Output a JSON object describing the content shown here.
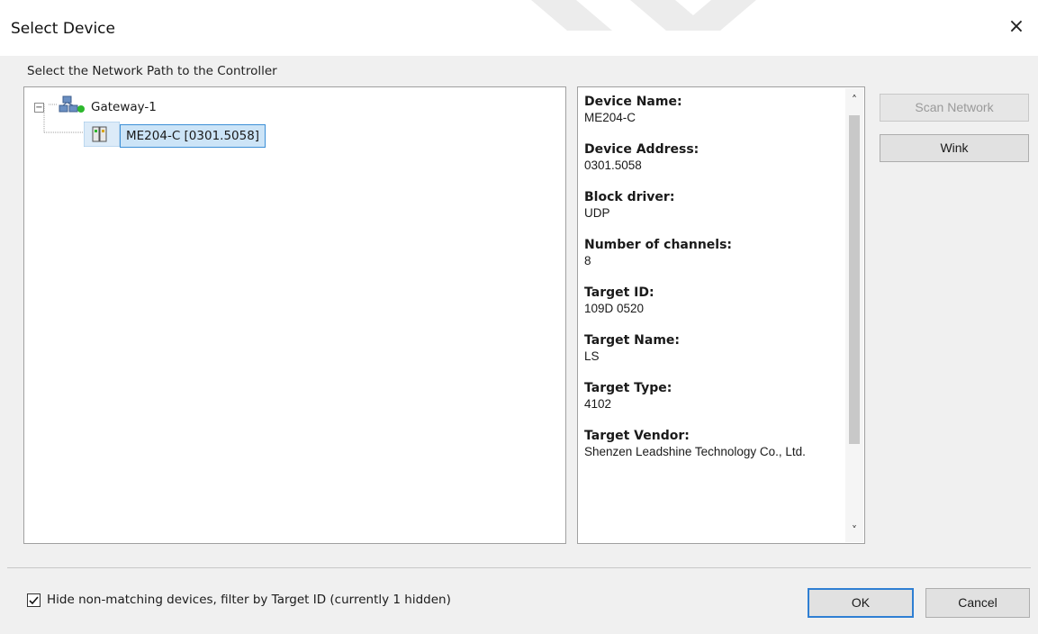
{
  "dialog": {
    "title": "Select Device",
    "close_glyph": "×"
  },
  "tree_section": {
    "label": "Select the Network Path to the Controller",
    "gateway": {
      "label": "Gateway-1",
      "icon": "network-gateway-icon",
      "status_color": "#2db82d",
      "expander": "−"
    },
    "device": {
      "label": "ME204-C [0301.5058]",
      "icon": "device-module-icon"
    }
  },
  "info": {
    "items": [
      {
        "label": "Device Name:",
        "value": "ME204-C"
      },
      {
        "label": "Device Address:",
        "value": "0301.5058"
      },
      {
        "label": "Block driver:",
        "value": "UDP"
      },
      {
        "label": "Number of channels:",
        "value": "8"
      },
      {
        "label": "Target ID:",
        "value": "109D 0520"
      },
      {
        "label": "Target Name:",
        "value": "LS"
      },
      {
        "label": "Target Type:",
        "value": "4102"
      },
      {
        "label": "Target Vendor:",
        "value": "Shenzen Leadshine Technology Co., Ltd."
      }
    ],
    "scroll_up": "˄",
    "scroll_down": "˅"
  },
  "buttons": {
    "scan_network": "Scan Network",
    "wink": "Wink",
    "ok": "OK",
    "cancel": "Cancel"
  },
  "filter": {
    "label": "Hide non-matching devices, filter by Target ID (currently 1 hidden)",
    "checked": true
  }
}
